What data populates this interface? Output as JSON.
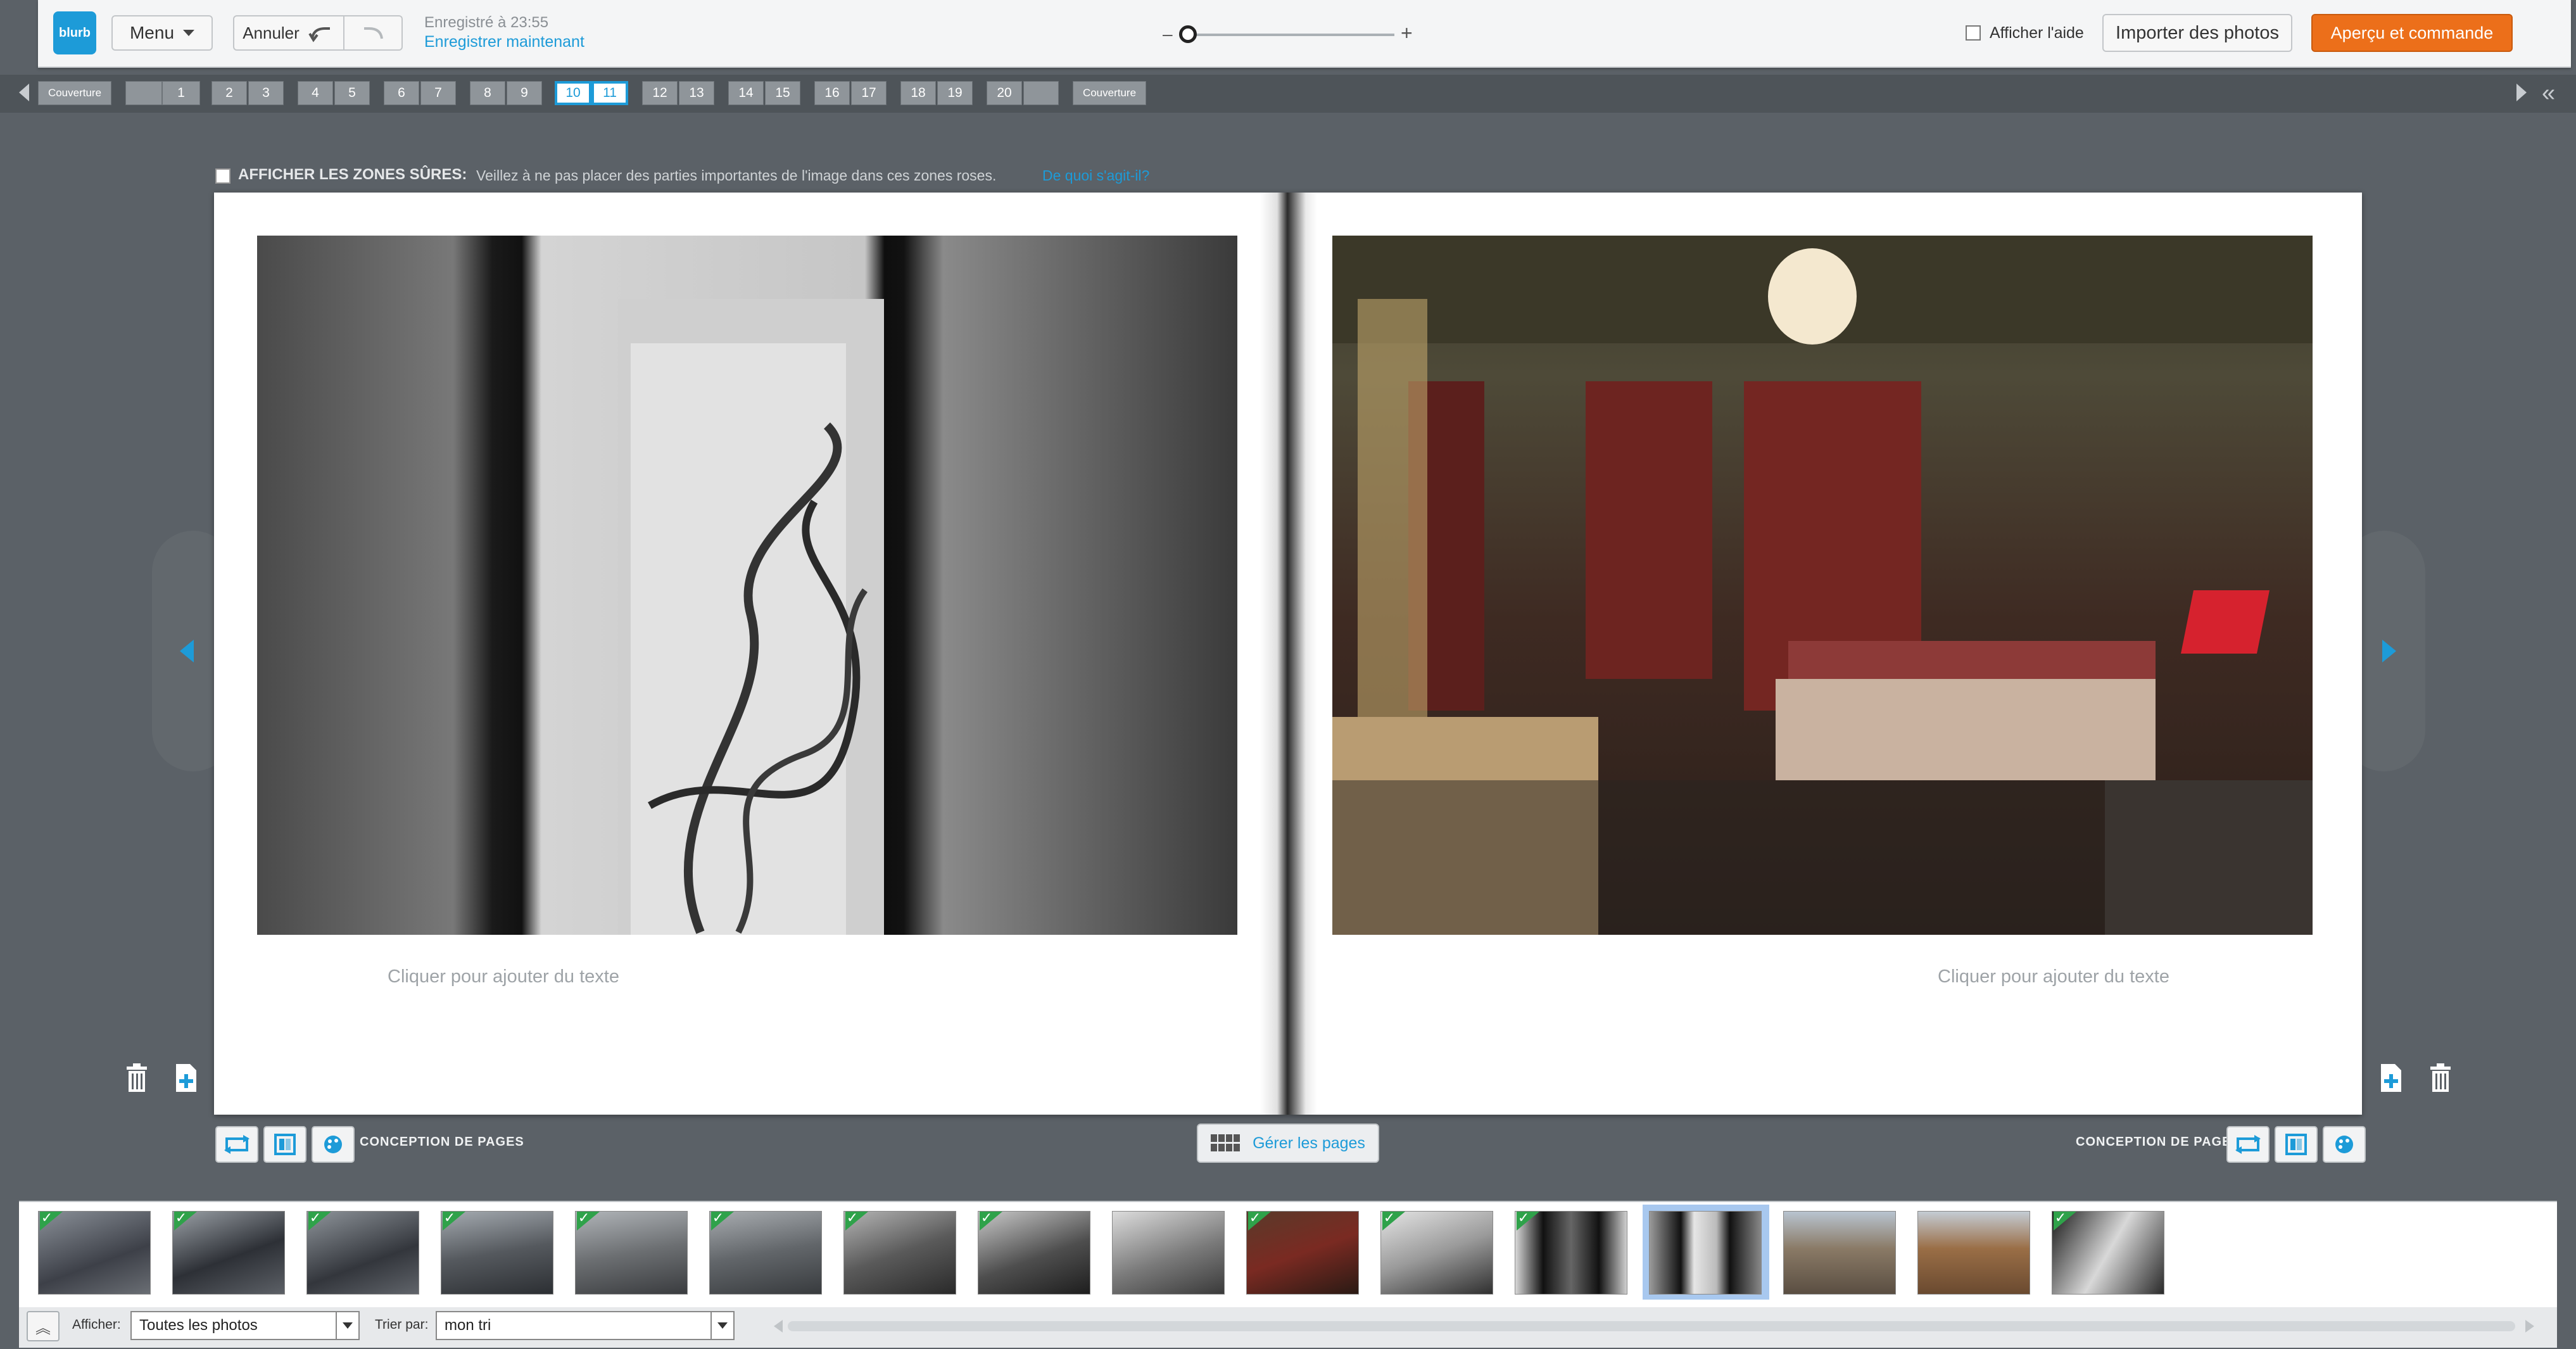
{
  "app": {
    "logo": "blurb",
    "accent": "#1d9bd8",
    "order_color": "#ec6f1a"
  },
  "toolbar": {
    "menu_label": "Menu",
    "undo_label": "Annuler",
    "saved_text": "Enregistré à 23:55",
    "save_now_label": "Enregistrer maintenant",
    "zoom_minus": "–",
    "zoom_plus": "+",
    "help_label": "Afficher l'aide",
    "import_label": "Importer des photos",
    "order_label": "Aperçu et commande"
  },
  "pages": {
    "cover_front": "Couverture",
    "cover_back": "Couverture",
    "numbers": [
      "",
      "1",
      "2",
      "3",
      "4",
      "5",
      "6",
      "7",
      "8",
      "9",
      "10",
      "11",
      "12",
      "13",
      "14",
      "15",
      "16",
      "17",
      "18",
      "19",
      "20",
      ""
    ],
    "active": [
      "10",
      "11"
    ]
  },
  "safe_zones": {
    "title": "AFFICHER LES ZONES SÛRES:",
    "description": "Veillez à ne pas placer des parties importantes de l'image dans ces zones roses.",
    "link": "De quoi s'agit-il?"
  },
  "spread": {
    "left_text_placeholder": "Cliquer pour ajouter du texte",
    "right_text_placeholder": "Cliquer pour ajouter du texte"
  },
  "tools": {
    "left_design_label": "CONCEPTION DE PAGES",
    "right_design_label": "CONCEPTION DE PAGES",
    "manage_pages_label": "Gérer les pages"
  },
  "tray": {
    "photos": [
      {
        "checked": true
      },
      {
        "checked": true
      },
      {
        "checked": true
      },
      {
        "checked": true
      },
      {
        "checked": true
      },
      {
        "checked": true
      },
      {
        "checked": true
      },
      {
        "checked": true
      },
      {
        "checked": false
      },
      {
        "checked": true
      },
      {
        "checked": true
      },
      {
        "checked": true
      },
      {
        "checked": false,
        "selected": true
      },
      {
        "checked": false
      },
      {
        "checked": false
      },
      {
        "checked": true
      }
    ],
    "show_label": "Afficher:",
    "show_value": "Toutes les photos",
    "sort_label": "Trier par:",
    "sort_value": "mon tri"
  }
}
